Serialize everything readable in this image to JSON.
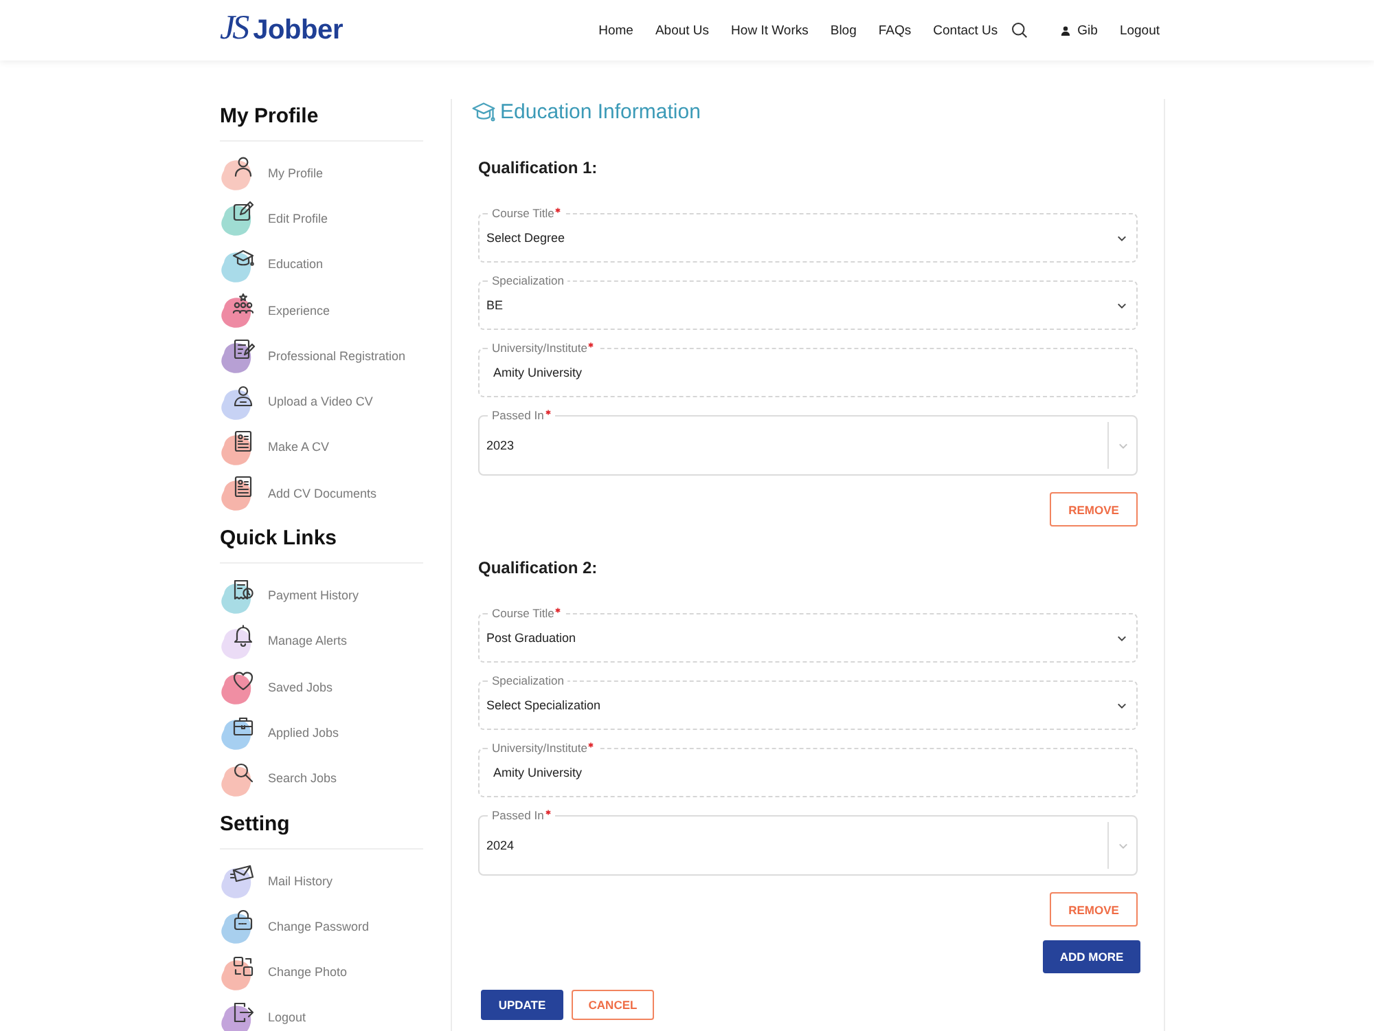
{
  "header": {
    "logo": {
      "mark": "JS",
      "name": "Jobber"
    },
    "nav": [
      "Home",
      "About Us",
      "How It Works",
      "Blog",
      "FAQs",
      "Contact Us"
    ],
    "user": "Gib",
    "logout": "Logout"
  },
  "sidebar": {
    "sections": [
      {
        "title": "My Profile",
        "items": [
          {
            "label": "My Profile",
            "color": "#f8c8bf"
          },
          {
            "label": "Edit Profile",
            "color": "#9fdcd2"
          },
          {
            "label": "Education",
            "color": "#a9dbe9"
          },
          {
            "label": "Experience",
            "color": "#ee8aa3"
          },
          {
            "label": "Professional Registration",
            "color": "#b7a0d4"
          },
          {
            "label": "Upload a Video CV",
            "color": "#c7d2f4"
          },
          {
            "label": "Make A CV",
            "color": "#f6b4aa"
          },
          {
            "label": "Add CV Documents",
            "color": "#f6b4aa"
          }
        ]
      },
      {
        "title": "Quick Links",
        "items": [
          {
            "label": "Payment History",
            "color": "#a8dce5"
          },
          {
            "label": "Manage Alerts",
            "color": "#ebdcf6"
          },
          {
            "label": "Saved Jobs",
            "color": "#f08ea3"
          },
          {
            "label": "Applied Jobs",
            "color": "#a6cff1"
          },
          {
            "label": "Search Jobs",
            "color": "#f8bfb5"
          }
        ]
      },
      {
        "title": "Setting",
        "items": [
          {
            "label": "Mail History",
            "color": "#d2d4f5"
          },
          {
            "label": "Change Password",
            "color": "#a8cfee"
          },
          {
            "label": "Change Photo",
            "color": "#f7b8ad"
          },
          {
            "label": "Logout",
            "color": "#c3a4db"
          }
        ]
      }
    ]
  },
  "main": {
    "title": "Education Information",
    "qualifications": [
      {
        "title": "Qualification 1:",
        "fields": [
          {
            "kind": "select",
            "label": "Course Title",
            "required": true,
            "value": "Select Degree"
          },
          {
            "kind": "select",
            "label": "Specialization",
            "required": false,
            "value": "BE"
          },
          {
            "kind": "input",
            "label": "University/Institute",
            "required": true,
            "value": "Amity University"
          },
          {
            "kind": "dropdown",
            "label": "Passed In",
            "required": true,
            "value": "2023"
          }
        ],
        "remove": "REMOVE"
      },
      {
        "title": "Qualification 2:",
        "fields": [
          {
            "kind": "select",
            "label": "Course Title",
            "required": true,
            "value": "Post Graduation"
          },
          {
            "kind": "select",
            "label": "Specialization",
            "required": false,
            "value": "Select Specialization"
          },
          {
            "kind": "input",
            "label": "University/Institute",
            "required": true,
            "value": "Amity University"
          },
          {
            "kind": "dropdown",
            "label": "Passed In",
            "required": true,
            "value": "2024"
          }
        ],
        "remove": "REMOVE"
      }
    ],
    "add_more": "ADD MORE",
    "actions": [
      {
        "kind": "primary",
        "label": "UPDATE"
      },
      {
        "kind": "outline",
        "label": "CANCEL"
      }
    ]
  }
}
